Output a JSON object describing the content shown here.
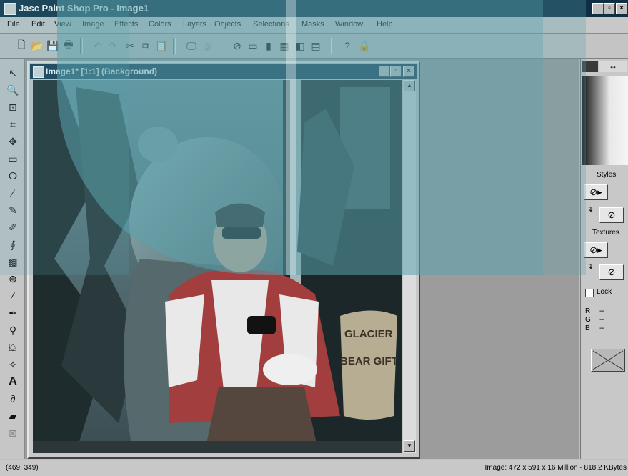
{
  "window": {
    "title": "Jasc Paint Shop Pro - Image1"
  },
  "menu": {
    "items": [
      "File",
      "Edit",
      "View",
      "Image",
      "Effects",
      "Colors",
      "Layers",
      "Objects",
      "Selections",
      "Masks",
      "Window",
      "Help"
    ]
  },
  "toolbar": {
    "buttons": [
      "new-icon",
      "open-icon",
      "save-icon",
      "print-icon",
      "undo-icon",
      "redo-icon",
      "cut-icon",
      "copy-icon",
      "paste-icon",
      "full-screen-preview-icon",
      "browse-icon",
      "toggle-tool-palette-icon",
      "toggle-style-bar-icon",
      "toggle-histogram-icon",
      "toggle-layer-palette-icon",
      "toggle-overview-icon",
      "context-help-icon",
      "lock-icon"
    ]
  },
  "tools": [
    "arrow-tool-icon",
    "zoom-tool-icon",
    "deformation-tool-icon",
    "crop-tool-icon",
    "mover-tool-icon",
    "selection-tool-icon",
    "freehand-tool-icon",
    "dropper-tool-icon",
    "paintbrush-tool-icon",
    "clone-brush-icon",
    "color-replacer-icon",
    "retouch-tool-icon",
    "scratch-remover-icon",
    "eraser-tool-icon",
    "picture-tube-icon",
    "airbrush-icon",
    "flood-fill-icon",
    "text-tool-icon",
    "draw-tool-icon",
    "preset-shapes-icon",
    "object-selector-icon"
  ],
  "image_window": {
    "title": "Image1* [1:1] (Background)",
    "sign_text_1": "GLACIER",
    "sign_text_2": "BEAR GIFT"
  },
  "right_palette": {
    "styles_label": "Styles",
    "textures_label": "Textures",
    "lock_label": "Lock",
    "lock_checked": false,
    "r_label": "R",
    "g_label": "G",
    "b_label": "B",
    "r_value": "--",
    "g_value": "--",
    "b_value": "--"
  },
  "status": {
    "coords": "(469, 349)",
    "image_info": "Image:  472 x 591 x 16 Million - 818.2 KBytes"
  },
  "colors": {
    "title_bar": "#0f2f45",
    "overlay_teal": "#5aa3ad"
  }
}
